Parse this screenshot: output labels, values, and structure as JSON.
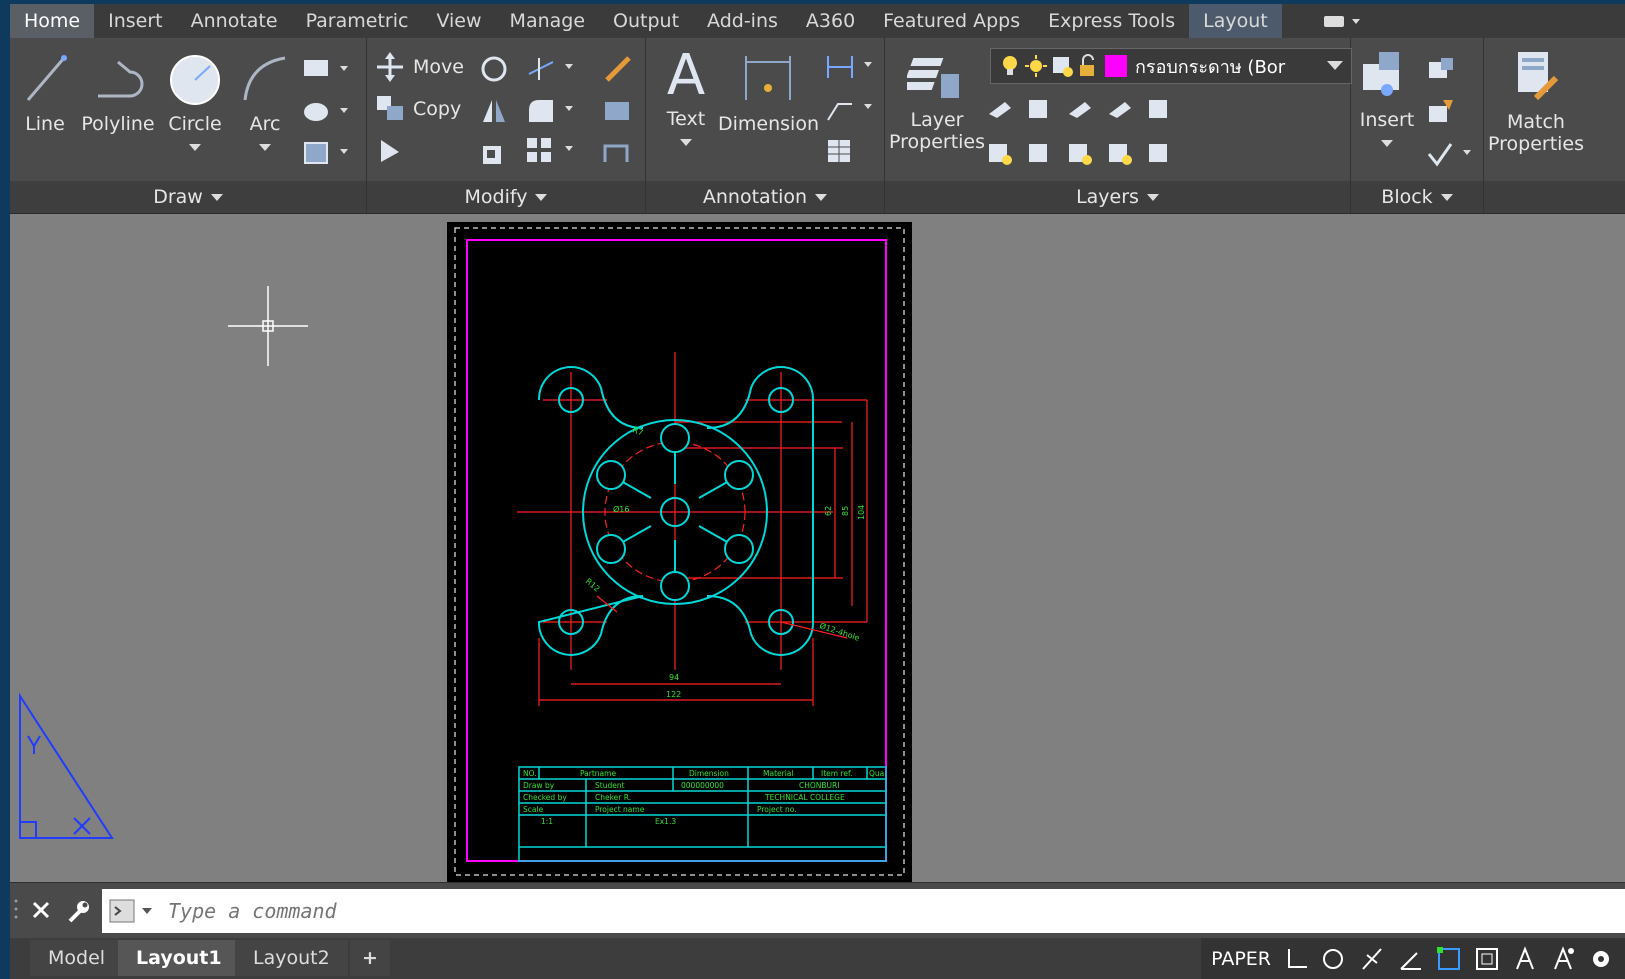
{
  "tabs": [
    "Home",
    "Insert",
    "Annotate",
    "Parametric",
    "View",
    "Manage",
    "Output",
    "Add-ins",
    "A360",
    "Featured Apps",
    "Express Tools",
    "Layout"
  ],
  "draw": {
    "title": "Draw",
    "line": "Line",
    "polyline": "Polyline",
    "circle": "Circle",
    "arc": "Arc"
  },
  "modify": {
    "title": "Modify",
    "move": "Move",
    "copy": "Copy"
  },
  "annotation": {
    "title": "Annotation",
    "text": "Text",
    "dimension": "Dimension"
  },
  "layers": {
    "title": "Layers",
    "layer_properties_1": "Layer",
    "layer_properties_2": "Properties",
    "current_layer": "กรอบกระดาษ (Bor"
  },
  "block": {
    "title": "Block",
    "insert": "Insert"
  },
  "match": {
    "line1": "Match",
    "line2": "Properties"
  },
  "command": {
    "placeholder": "Type a command"
  },
  "layout_tabs": {
    "model": "Model",
    "layout1": "Layout1",
    "layout2": "Layout2",
    "add": "+"
  },
  "status": {
    "paper": "PAPER"
  },
  "drawing": {
    "dims": {
      "r7": "R7",
      "d16": "Ø16",
      "r12": "R12",
      "d12": "Ø12-4hole",
      "w94": "94",
      "w122": "122",
      "h62": "62",
      "h85": "85",
      "h104": "104"
    },
    "titleblock": {
      "no": "NO.",
      "partname": "Partname",
      "dimension": "Dimension",
      "material": "Material",
      "itemref": "Item ref.",
      "qua": "Qua",
      "drawby": "Draw by",
      "student": "Student",
      "code": "000000000",
      "college1": "CHONBURI",
      "checkedby": "Checked by",
      "checker": "Cheker R.",
      "college2": "TECHNICAL COLLEGE",
      "scale": "Scale",
      "scaleval": "1:1",
      "projectname": "Project name",
      "projectno": "Project no.",
      "ex": "Ex1.3"
    }
  },
  "colors": {
    "accent_tab": "#5a5f66",
    "layer_swatch": "#ff00ff",
    "cyan": "#00d8d8",
    "red": "#ff2020",
    "green": "#30e030",
    "magenta": "#ff00ff"
  }
}
